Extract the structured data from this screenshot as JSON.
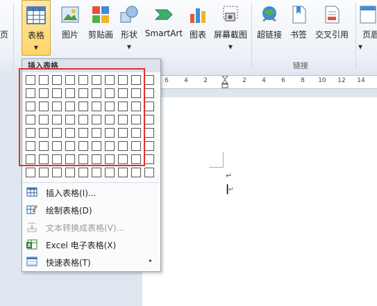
{
  "ribbon": {
    "left_partial_label": "页",
    "table_button": "表格",
    "picture": "图片",
    "clip_art": "剪贴画",
    "shapes": "形状",
    "smartart": "SmartArt",
    "chart": "图表",
    "screenshot": "屏幕截图",
    "hyperlink": "超链接",
    "bookmark": "书签",
    "cross_ref": "交叉引用",
    "header_partial": "页眉",
    "links_group": "链接"
  },
  "ruler": {
    "ticks": [
      "6",
      "4",
      "2",
      "2",
      "4",
      "6",
      "8",
      "10",
      "12",
      "14"
    ]
  },
  "table_menu": {
    "header": "插入表格",
    "grid": {
      "columns": 10,
      "rows": 8
    },
    "items": [
      {
        "label": "插入表格(I)...",
        "icon": "insert-table-icon",
        "enabled": true
      },
      {
        "label": "绘制表格(D)",
        "icon": "draw-table-icon",
        "enabled": true
      },
      {
        "label": "文本转换成表格(V)...",
        "icon": "text-to-table-icon",
        "enabled": false
      },
      {
        "label": "Excel 电子表格(X)",
        "icon": "excel-spreadsheet-icon",
        "enabled": true
      },
      {
        "label": "快速表格(T)",
        "icon": "quick-tables-icon",
        "enabled": true,
        "submenu": "▸"
      }
    ]
  },
  "document": {
    "para_mark": "↵",
    "cursor": "|"
  },
  "colors": {
    "highlight": "#e03030",
    "active_button": "#ffd46a"
  }
}
